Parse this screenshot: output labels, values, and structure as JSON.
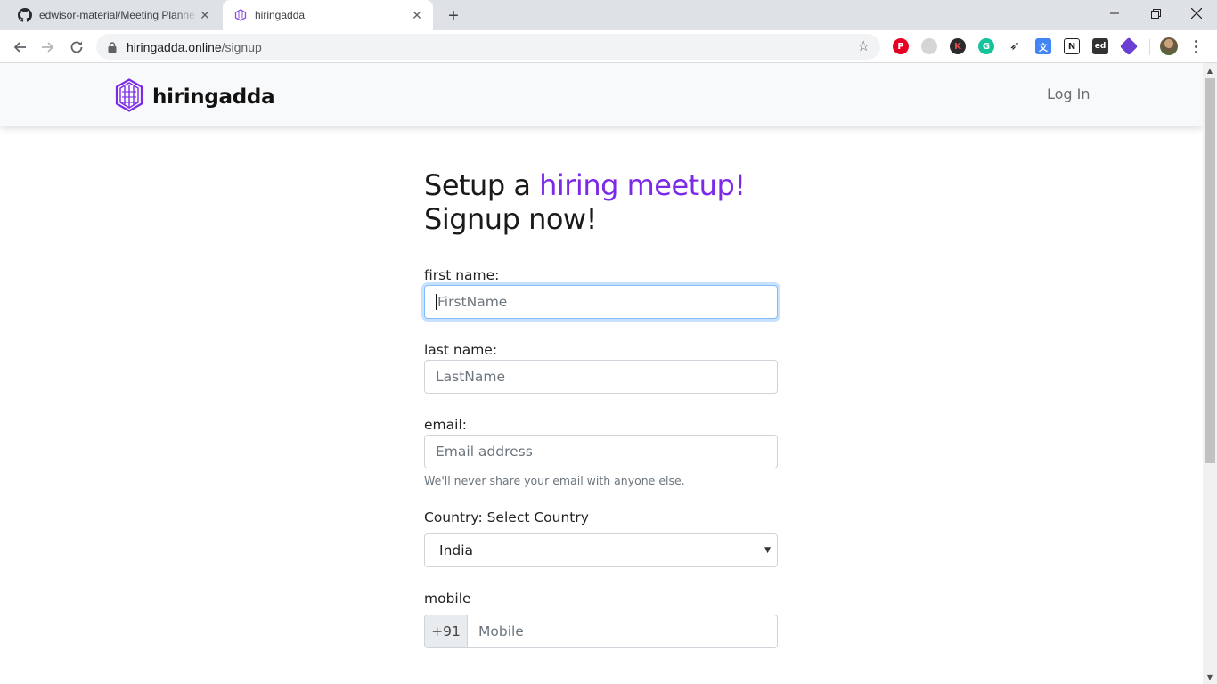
{
  "browser": {
    "tabs": [
      {
        "title": "edwisor-material/Meeting Planne",
        "favicon": "github-icon",
        "active": false
      },
      {
        "title": "hiringadda",
        "favicon": "hiringadda-logo-icon",
        "active": true
      }
    ],
    "url_host": "hiringadda.online",
    "url_path": "/signup",
    "extensions": [
      "pinterest-icon",
      "extension-grey-icon",
      "k-extension-icon",
      "grammarly-icon",
      "bird-extension-icon",
      "google-translate-icon",
      "notion-icon",
      "edpuzzle-icon",
      "cube-extension-icon"
    ]
  },
  "navbar": {
    "brand": "hiringadda",
    "login_label": "Log In"
  },
  "form": {
    "heading_prefix": "Setup a ",
    "heading_accent": "hiring meetup!",
    "heading_line2": "Signup now!",
    "first_name_label": "first name:",
    "first_name_placeholder": "FirstName",
    "last_name_label": "last name:",
    "last_name_placeholder": "LastName",
    "email_label": "email:",
    "email_placeholder": "Email address",
    "email_help": "We'll never share your email with anyone else.",
    "country_label": "Country: Select Country",
    "country_selected": "India",
    "mobile_label": "mobile",
    "mobile_prefix": "+91",
    "mobile_placeholder": "Mobile"
  },
  "colors": {
    "accent": "#7c2ae8",
    "navbar_bg": "#f8f9fa",
    "focus_border": "#80bdff"
  }
}
